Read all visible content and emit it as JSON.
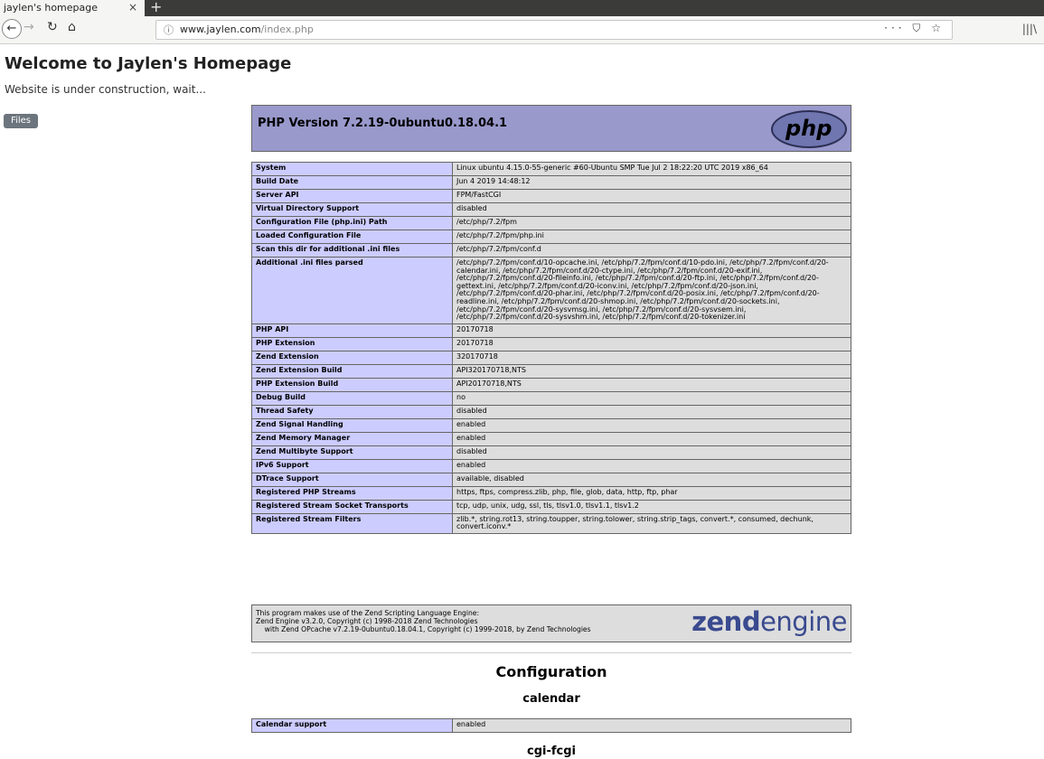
{
  "browser": {
    "tab_title": "jaylen's homepage",
    "tab_close": "×",
    "new_tab": "+",
    "url_host": "www.jaylen.com",
    "url_path": "/index.php",
    "url_actions": "··· ⛉ ☆",
    "library": "|||\\"
  },
  "page": {
    "title": "Welcome to Jaylen's Homepage",
    "subtitle": "Website is under construction, wait...",
    "files_button": "Files"
  },
  "phpinfo": {
    "version": "PHP Version 7.2.19-0ubuntu0.18.04.1",
    "logo_text": "php",
    "rows": [
      {
        "k": "System",
        "v": "Linux ubuntu 4.15.0-55-generic #60-Ubuntu SMP Tue Jul 2 18:22:20 UTC 2019 x86_64"
      },
      {
        "k": "Build Date",
        "v": "Jun 4 2019 14:48:12"
      },
      {
        "k": "Server API",
        "v": "FPM/FastCGI"
      },
      {
        "k": "Virtual Directory Support",
        "v": "disabled"
      },
      {
        "k": "Configuration File (php.ini) Path",
        "v": "/etc/php/7.2/fpm"
      },
      {
        "k": "Loaded Configuration File",
        "v": "/etc/php/7.2/fpm/php.ini"
      },
      {
        "k": "Scan this dir for additional .ini files",
        "v": "/etc/php/7.2/fpm/conf.d"
      },
      {
        "k": "Additional .ini files parsed",
        "v": "/etc/php/7.2/fpm/conf.d/10-opcache.ini, /etc/php/7.2/fpm/conf.d/10-pdo.ini, /etc/php/7.2/fpm/conf.d/20-calendar.ini, /etc/php/7.2/fpm/conf.d/20-ctype.ini, /etc/php/7.2/fpm/conf.d/20-exif.ini, /etc/php/7.2/fpm/conf.d/20-fileinfo.ini, /etc/php/7.2/fpm/conf.d/20-ftp.ini, /etc/php/7.2/fpm/conf.d/20-gettext.ini, /etc/php/7.2/fpm/conf.d/20-iconv.ini, /etc/php/7.2/fpm/conf.d/20-json.ini, /etc/php/7.2/fpm/conf.d/20-phar.ini, /etc/php/7.2/fpm/conf.d/20-posix.ini, /etc/php/7.2/fpm/conf.d/20-readline.ini, /etc/php/7.2/fpm/conf.d/20-shmop.ini, /etc/php/7.2/fpm/conf.d/20-sockets.ini, /etc/php/7.2/fpm/conf.d/20-sysvmsg.ini, /etc/php/7.2/fpm/conf.d/20-sysvsem.ini, /etc/php/7.2/fpm/conf.d/20-sysvshm.ini, /etc/php/7.2/fpm/conf.d/20-tokenizer.ini"
      },
      {
        "k": "PHP API",
        "v": "20170718"
      },
      {
        "k": "PHP Extension",
        "v": "20170718"
      },
      {
        "k": "Zend Extension",
        "v": "320170718"
      },
      {
        "k": "Zend Extension Build",
        "v": "API320170718,NTS"
      },
      {
        "k": "PHP Extension Build",
        "v": "API20170718,NTS"
      },
      {
        "k": "Debug Build",
        "v": "no"
      },
      {
        "k": "Thread Safety",
        "v": "disabled"
      },
      {
        "k": "Zend Signal Handling",
        "v": "enabled"
      },
      {
        "k": "Zend Memory Manager",
        "v": "enabled"
      },
      {
        "k": "Zend Multibyte Support",
        "v": "disabled"
      },
      {
        "k": "IPv6 Support",
        "v": "enabled"
      },
      {
        "k": "DTrace Support",
        "v": "available, disabled"
      },
      {
        "k": "Registered PHP Streams",
        "v": "https, ftps, compress.zlib, php, file, glob, data, http, ftp, phar"
      },
      {
        "k": "Registered Stream Socket Transports",
        "v": "tcp, udp, unix, udg, ssl, tls, tlsv1.0, tlsv1.1, tlsv1.2"
      },
      {
        "k": "Registered Stream Filters",
        "v": "zlib.*, string.rot13, string.toupper, string.tolower, string.strip_tags, convert.*, consumed, dechunk, convert.iconv.*"
      }
    ],
    "zend_text": "This program makes use of the Zend Scripting Language Engine:\nZend Engine v3.2.0, Copyright (c) 1998-2018 Zend Technologies\n    with Zend OPcache v7.2.19-0ubuntu0.18.04.1, Copyright (c) 1999-2018, by Zend Technologies",
    "zend_logo_a": "zend",
    "zend_logo_b": "engine",
    "configuration_heading": "Configuration",
    "calendar_heading": "calendar",
    "calendar_rows": [
      {
        "k": "Calendar support",
        "v": "enabled"
      }
    ],
    "cgi_heading": "cgi-fcgi"
  }
}
